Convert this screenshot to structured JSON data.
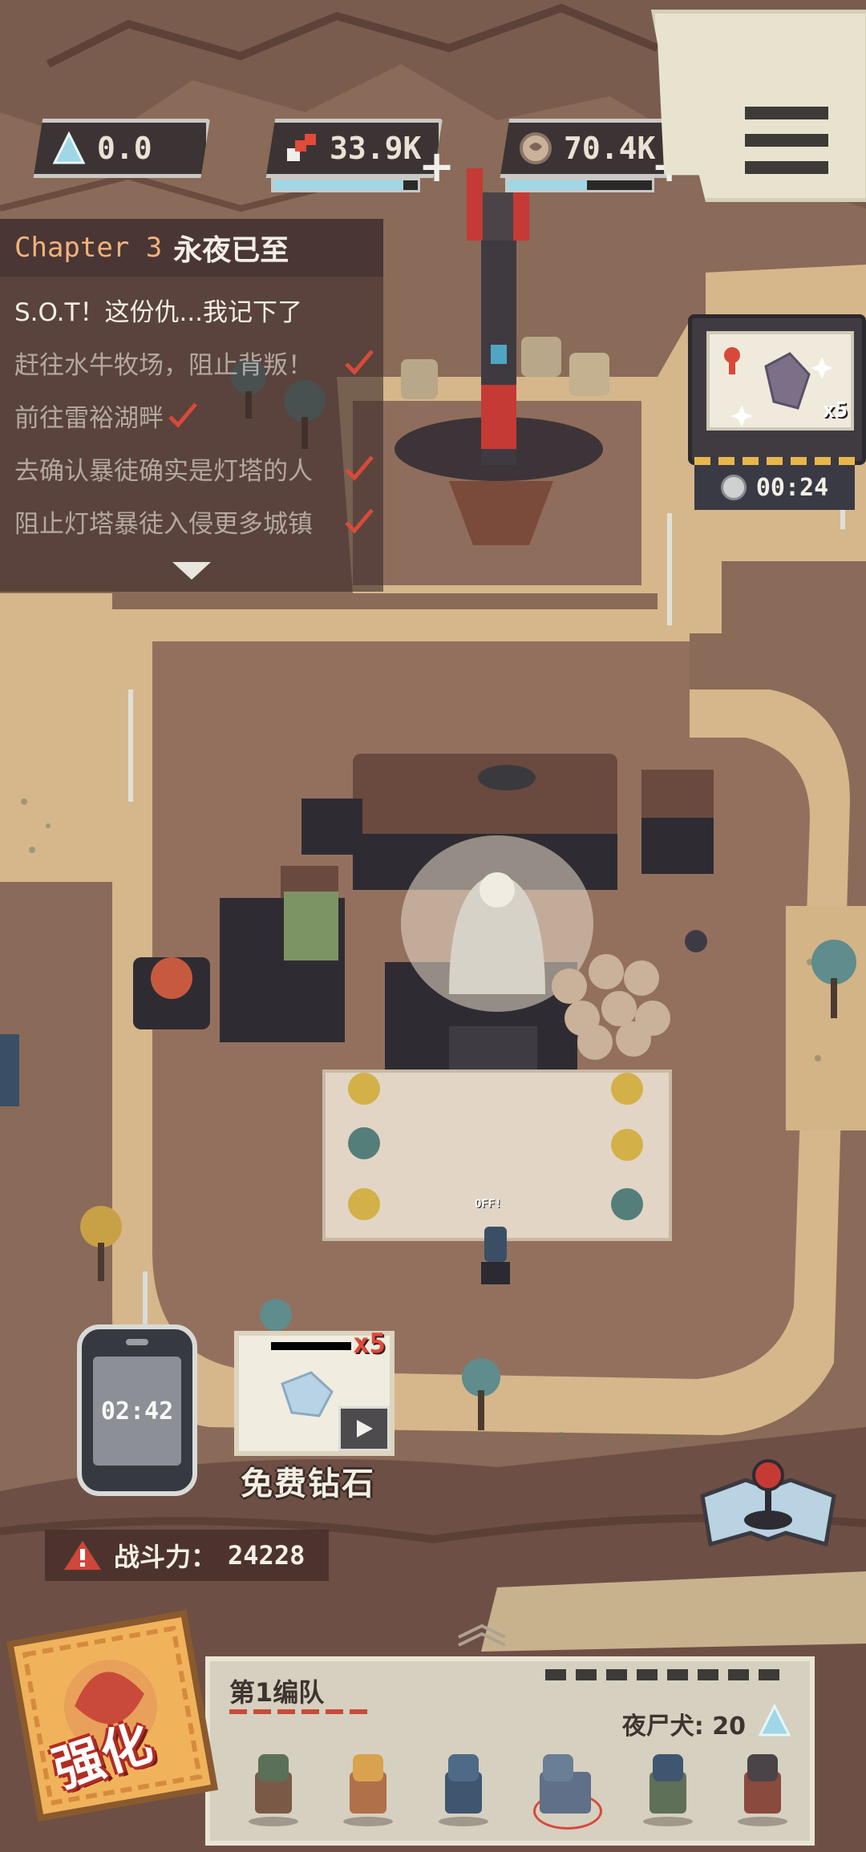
{
  "resources": [
    {
      "id": "crystal",
      "value": "0.0",
      "icon": "crystal-icon"
    },
    {
      "id": "parts",
      "value": "33.9K",
      "icon": "parts-icon"
    },
    {
      "id": "coins",
      "value": "70.4K",
      "icon": "coin-icon"
    }
  ],
  "quest": {
    "chapter": "Chapter 3",
    "title": "永夜已至",
    "items": [
      {
        "text": "S.O.T！这份仇...我记下了",
        "done": false
      },
      {
        "text": "赶往水牛牧场，阻止背叛！",
        "done": true
      },
      {
        "text": "前往雷裕湖畔",
        "done": true
      },
      {
        "text": "去确认暴徒确实是灯塔的人",
        "done": true
      },
      {
        "text": "阻止灯塔暴徒入侵更多城镇",
        "done": true
      }
    ]
  },
  "event": {
    "multiplier": "x5",
    "timer": "00:24"
  },
  "phone": {
    "timer": "02:42"
  },
  "free_diamond": {
    "label": "免费钻石",
    "multiplier": "x5"
  },
  "power": {
    "label": "战斗力：",
    "value": "24228"
  },
  "team": {
    "name": "第1编队",
    "count_label": "夜尸犬: 20"
  },
  "upgrade": {
    "label": "强化"
  },
  "map_labels": {
    "off_sign": "OFF!"
  },
  "colors": {
    "ground": "#8a6a58",
    "path": "#d6b78b",
    "accent_red": "#c94a3a",
    "panel_light": "#e7e3cf"
  }
}
